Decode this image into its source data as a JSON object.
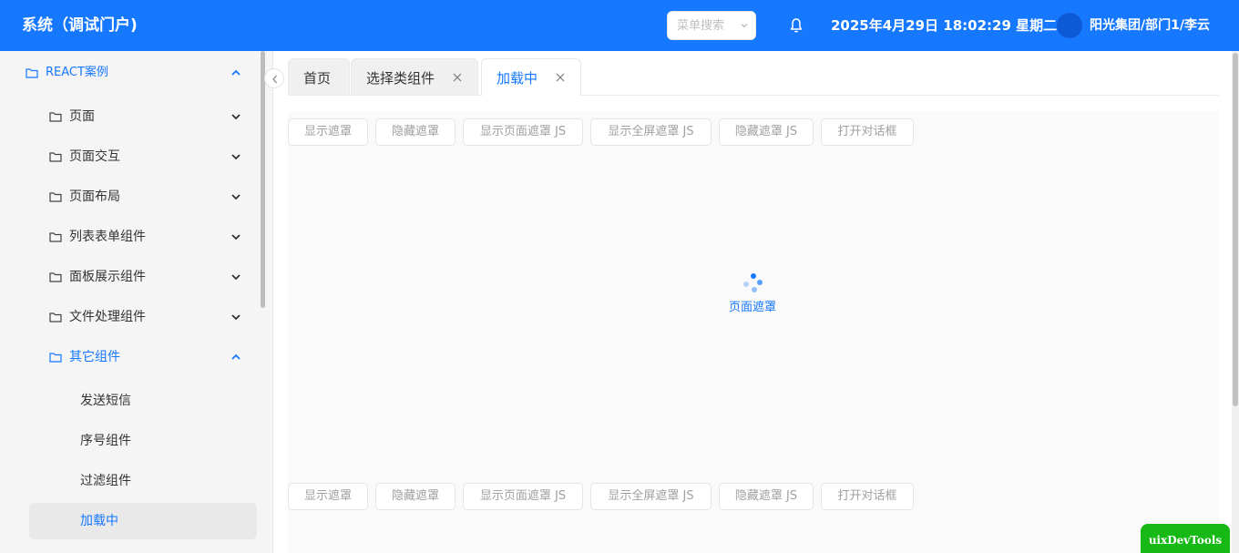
{
  "header": {
    "title": "系统（调试门户)",
    "search_placeholder": "菜单搜索",
    "datetime": "2025年4月29日 18:02:29 星期二",
    "user": "阳光集团/部门1/李云",
    "bell_icon": "bell-icon",
    "bg_color": "#1677ff"
  },
  "sidebar": {
    "items": [
      {
        "label": "REACT案例",
        "level": 0,
        "expanded": true,
        "active": true
      },
      {
        "label": "页面",
        "level": 1,
        "expanded": false
      },
      {
        "label": "页面交互",
        "level": 1,
        "expanded": false
      },
      {
        "label": "页面布局",
        "level": 1,
        "expanded": false
      },
      {
        "label": "列表表单组件",
        "level": 1,
        "expanded": false
      },
      {
        "label": "面板展示组件",
        "level": 1,
        "expanded": false
      },
      {
        "label": "文件处理组件",
        "level": 1,
        "expanded": false
      },
      {
        "label": "其它组件",
        "level": 1,
        "expanded": true,
        "active": true
      },
      {
        "label": "发送短信",
        "level": 2
      },
      {
        "label": "序号组件",
        "level": 2
      },
      {
        "label": "过滤组件",
        "level": 2
      },
      {
        "label": "加载中",
        "level": 2,
        "selected": true
      }
    ]
  },
  "tabs": [
    {
      "label": "首页",
      "closable": false
    },
    {
      "label": "选择类组件",
      "closable": true
    },
    {
      "label": "加载中",
      "closable": true,
      "active": true
    }
  ],
  "content": {
    "buttons": [
      "显示遮罩",
      "隐藏遮罩",
      "显示页面遮罩 JS",
      "显示全屏遮罩 JS",
      "隐藏遮罩 JS",
      "打开对话框"
    ],
    "mask_text": "页面遮罩"
  },
  "devtools": {
    "label": "uixDevTools"
  },
  "colors": {
    "accent": "#1677ff",
    "devtools_bg": "#17b917"
  }
}
